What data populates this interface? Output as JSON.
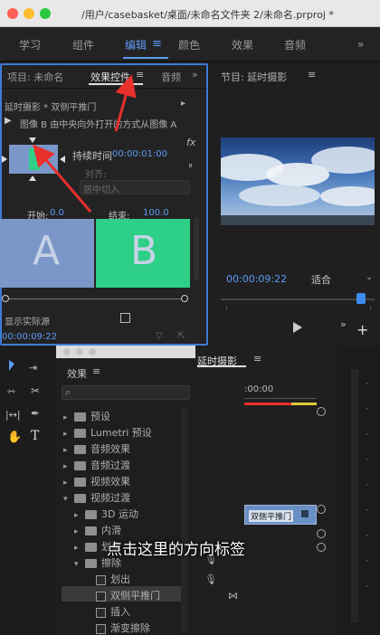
{
  "window": {
    "title": "/用户/casebasket/桌面/未命名文件夹 2/未命名.prproj *"
  },
  "workspaces": {
    "items": [
      "学习",
      "组件",
      "编辑",
      "颜色",
      "效果",
      "音频"
    ],
    "active": "编辑"
  },
  "effect_controls": {
    "tab_project": "项目: 未命名",
    "tab_effect_controls": "效果控件",
    "tab_audio": "音频",
    "clip_path": "延时摄影 * 双侧平推门",
    "description": "图像 B 由中央向外打开的方式从图像 A",
    "duration_label": "持续时间",
    "duration_value": "00:00:01:00",
    "align_label": "对齐:",
    "align_value": "居中切入",
    "start_label": "开始:",
    "start_value": "0.0",
    "end_label": "结束:",
    "end_value": "100.0",
    "letter_a": "A",
    "letter_b": "B",
    "show_actual_sources": "显示实际源",
    "timecode": "00:00:09:22",
    "fx_label": "fx"
  },
  "program_monitor": {
    "title": "节目: 延时摄影",
    "timecode": "00:00:09:22",
    "fit_label": "适合"
  },
  "effects_panel": {
    "title": "效果",
    "items": [
      {
        "label": "预设",
        "level": 0,
        "kind": "folder",
        "expanded": false
      },
      {
        "label": "Lumetri 预设",
        "level": 0,
        "kind": "folder",
        "expanded": false
      },
      {
        "label": "音频效果",
        "level": 0,
        "kind": "folder",
        "expanded": false
      },
      {
        "label": "音频过渡",
        "level": 0,
        "kind": "folder",
        "expanded": false
      },
      {
        "label": "视频效果",
        "level": 0,
        "kind": "folder",
        "expanded": false
      },
      {
        "label": "视频过渡",
        "level": 0,
        "kind": "folder",
        "expanded": true
      },
      {
        "label": "3D 运动",
        "level": 1,
        "kind": "folder",
        "expanded": false
      },
      {
        "label": "内滑",
        "level": 1,
        "kind": "folder",
        "expanded": false
      },
      {
        "label": "划像",
        "level": 1,
        "kind": "folder",
        "expanded": false
      },
      {
        "label": "擦除",
        "level": 1,
        "kind": "folder",
        "expanded": true
      },
      {
        "label": "划出",
        "level": 2,
        "kind": "effect",
        "selected": false
      },
      {
        "label": "双侧平推门",
        "level": 2,
        "kind": "effect",
        "selected": true
      },
      {
        "label": "插入",
        "level": 2,
        "kind": "effect",
        "selected": false
      },
      {
        "label": "渐变擦除",
        "level": 2,
        "kind": "effect",
        "selected": false
      }
    ]
  },
  "timeline": {
    "title": "延时摄影",
    "ruler_time": ":00:00",
    "clip_label": "双侧平推门"
  },
  "caption": {
    "text": "点击这里的方向标签"
  },
  "colors": {
    "accent_blue": "#5c9bf5",
    "annotation_red": "#e8302c",
    "image_a": "#7b97c9",
    "image_b": "#2ecf87"
  }
}
